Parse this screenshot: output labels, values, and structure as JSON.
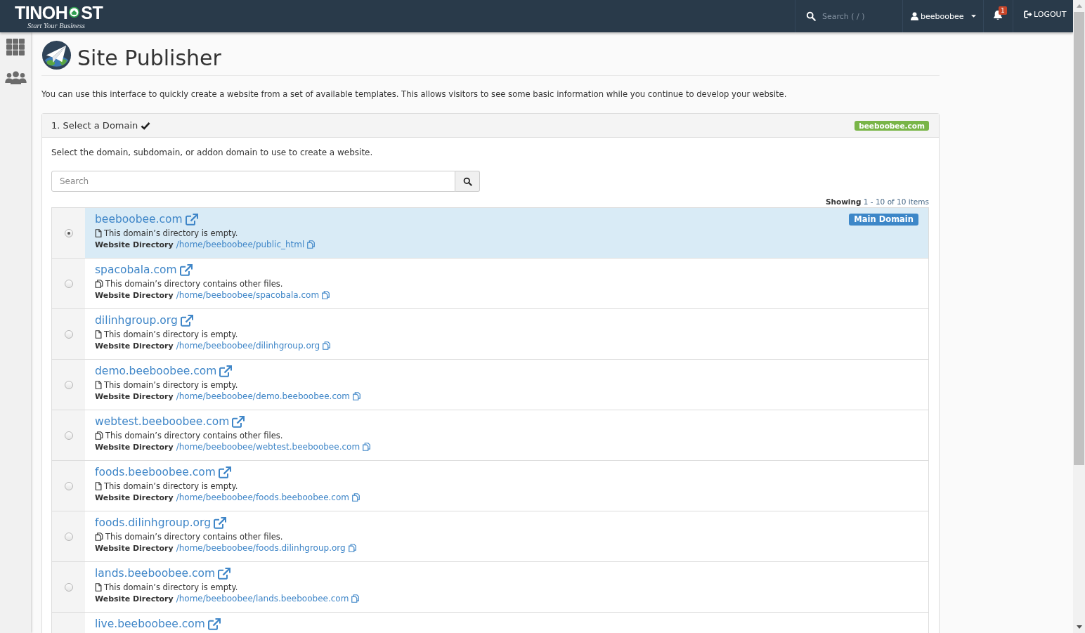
{
  "topbar": {
    "logo": {
      "left": "TINOH",
      "right": "ST",
      "tagline": "Start Your Business"
    },
    "search": {
      "placeholder": "Search ( / )"
    },
    "user": {
      "name": "beeboobee"
    },
    "notifications": {
      "count": "1"
    },
    "logout": "LOGOUT"
  },
  "page": {
    "title": "Site Publisher",
    "intro": "You can use this interface to quickly create a website from a set of available templates. This allows visitors to see some basic information while you continue to develop your website."
  },
  "step_panel": {
    "title": "1. Select a Domain",
    "completed": true,
    "domain_badge": "beeboobee.com",
    "instruction": "Select the domain, subdomain, or addon domain to use to create a website.",
    "search": {
      "placeholder": "Search"
    },
    "showing": {
      "label": "Showing",
      "range": "1 - 10 of 10 items"
    },
    "domains": [
      {
        "domain": "beeboobee.com",
        "selected": true,
        "badge": "Main Domain",
        "kind": "empty",
        "status": "This domain’s directory is empty.",
        "directory_label": "Website Directory",
        "directory": "/home/beeboobee/public_html"
      },
      {
        "domain": "spacobala.com",
        "selected": false,
        "kind": "has_files",
        "status": "This domain’s directory contains other files.",
        "directory_label": "Website Directory",
        "directory": "/home/beeboobee/spacobala.com"
      },
      {
        "domain": "dilinhgroup.org",
        "selected": false,
        "kind": "empty",
        "status": "This domain’s directory is empty.",
        "directory_label": "Website Directory",
        "directory": "/home/beeboobee/dilinhgroup.org"
      },
      {
        "domain": "demo.beeboobee.com",
        "selected": false,
        "kind": "empty",
        "status": "This domain’s directory is empty.",
        "directory_label": "Website Directory",
        "directory": "/home/beeboobee/demo.beeboobee.com"
      },
      {
        "domain": "webtest.beeboobee.com",
        "selected": false,
        "kind": "has_files",
        "status": "This domain’s directory contains other files.",
        "directory_label": "Website Directory",
        "directory": "/home/beeboobee/webtest.beeboobee.com"
      },
      {
        "domain": "foods.beeboobee.com",
        "selected": false,
        "kind": "empty",
        "status": "This domain’s directory is empty.",
        "directory_label": "Website Directory",
        "directory": "/home/beeboobee/foods.beeboobee.com"
      },
      {
        "domain": "foods.dilinhgroup.org",
        "selected": false,
        "kind": "has_files",
        "status": "This domain’s directory contains other files.",
        "directory_label": "Website Directory",
        "directory": "/home/beeboobee/foods.dilinhgroup.org"
      },
      {
        "domain": "lands.beeboobee.com",
        "selected": false,
        "kind": "empty",
        "status": "This domain’s directory is empty.",
        "directory_label": "Website Directory",
        "directory": "/home/beeboobee/lands.beeboobee.com"
      },
      {
        "domain": "live.beeboobee.com",
        "selected": false
      }
    ]
  }
}
